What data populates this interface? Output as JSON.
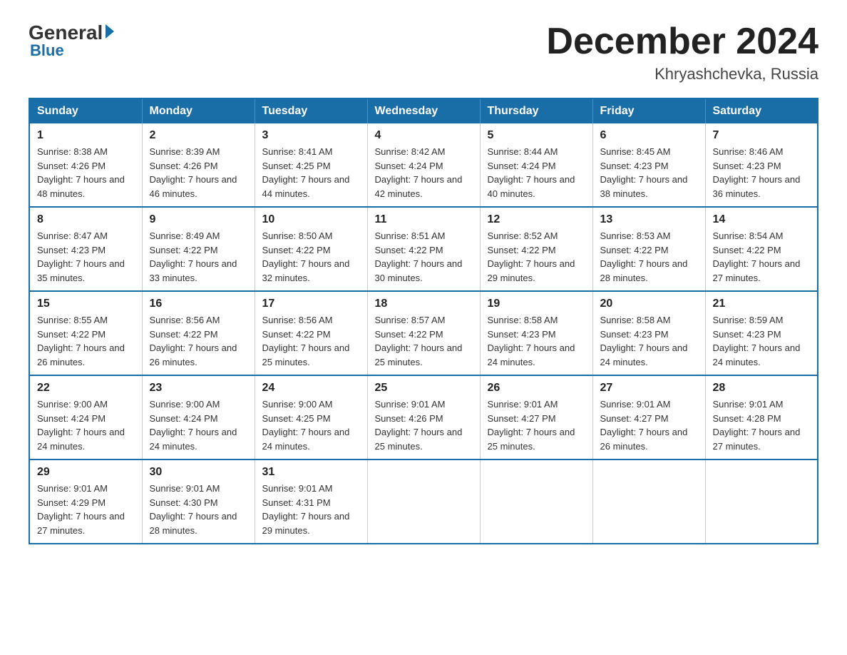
{
  "header": {
    "logo": {
      "general": "General",
      "blue": "Blue",
      "underline": "Blue"
    },
    "title": "December 2024",
    "location": "Khryashchevka, Russia"
  },
  "days_of_week": [
    "Sunday",
    "Monday",
    "Tuesday",
    "Wednesday",
    "Thursday",
    "Friday",
    "Saturday"
  ],
  "weeks": [
    [
      {
        "day": "1",
        "sunrise": "8:38 AM",
        "sunset": "4:26 PM",
        "daylight": "7 hours and 48 minutes."
      },
      {
        "day": "2",
        "sunrise": "8:39 AM",
        "sunset": "4:26 PM",
        "daylight": "7 hours and 46 minutes."
      },
      {
        "day": "3",
        "sunrise": "8:41 AM",
        "sunset": "4:25 PM",
        "daylight": "7 hours and 44 minutes."
      },
      {
        "day": "4",
        "sunrise": "8:42 AM",
        "sunset": "4:24 PM",
        "daylight": "7 hours and 42 minutes."
      },
      {
        "day": "5",
        "sunrise": "8:44 AM",
        "sunset": "4:24 PM",
        "daylight": "7 hours and 40 minutes."
      },
      {
        "day": "6",
        "sunrise": "8:45 AM",
        "sunset": "4:23 PM",
        "daylight": "7 hours and 38 minutes."
      },
      {
        "day": "7",
        "sunrise": "8:46 AM",
        "sunset": "4:23 PM",
        "daylight": "7 hours and 36 minutes."
      }
    ],
    [
      {
        "day": "8",
        "sunrise": "8:47 AM",
        "sunset": "4:23 PM",
        "daylight": "7 hours and 35 minutes."
      },
      {
        "day": "9",
        "sunrise": "8:49 AM",
        "sunset": "4:22 PM",
        "daylight": "7 hours and 33 minutes."
      },
      {
        "day": "10",
        "sunrise": "8:50 AM",
        "sunset": "4:22 PM",
        "daylight": "7 hours and 32 minutes."
      },
      {
        "day": "11",
        "sunrise": "8:51 AM",
        "sunset": "4:22 PM",
        "daylight": "7 hours and 30 minutes."
      },
      {
        "day": "12",
        "sunrise": "8:52 AM",
        "sunset": "4:22 PM",
        "daylight": "7 hours and 29 minutes."
      },
      {
        "day": "13",
        "sunrise": "8:53 AM",
        "sunset": "4:22 PM",
        "daylight": "7 hours and 28 minutes."
      },
      {
        "day": "14",
        "sunrise": "8:54 AM",
        "sunset": "4:22 PM",
        "daylight": "7 hours and 27 minutes."
      }
    ],
    [
      {
        "day": "15",
        "sunrise": "8:55 AM",
        "sunset": "4:22 PM",
        "daylight": "7 hours and 26 minutes."
      },
      {
        "day": "16",
        "sunrise": "8:56 AM",
        "sunset": "4:22 PM",
        "daylight": "7 hours and 26 minutes."
      },
      {
        "day": "17",
        "sunrise": "8:56 AM",
        "sunset": "4:22 PM",
        "daylight": "7 hours and 25 minutes."
      },
      {
        "day": "18",
        "sunrise": "8:57 AM",
        "sunset": "4:22 PM",
        "daylight": "7 hours and 25 minutes."
      },
      {
        "day": "19",
        "sunrise": "8:58 AM",
        "sunset": "4:23 PM",
        "daylight": "7 hours and 24 minutes."
      },
      {
        "day": "20",
        "sunrise": "8:58 AM",
        "sunset": "4:23 PM",
        "daylight": "7 hours and 24 minutes."
      },
      {
        "day": "21",
        "sunrise": "8:59 AM",
        "sunset": "4:23 PM",
        "daylight": "7 hours and 24 minutes."
      }
    ],
    [
      {
        "day": "22",
        "sunrise": "9:00 AM",
        "sunset": "4:24 PM",
        "daylight": "7 hours and 24 minutes."
      },
      {
        "day": "23",
        "sunrise": "9:00 AM",
        "sunset": "4:24 PM",
        "daylight": "7 hours and 24 minutes."
      },
      {
        "day": "24",
        "sunrise": "9:00 AM",
        "sunset": "4:25 PM",
        "daylight": "7 hours and 24 minutes."
      },
      {
        "day": "25",
        "sunrise": "9:01 AM",
        "sunset": "4:26 PM",
        "daylight": "7 hours and 25 minutes."
      },
      {
        "day": "26",
        "sunrise": "9:01 AM",
        "sunset": "4:27 PM",
        "daylight": "7 hours and 25 minutes."
      },
      {
        "day": "27",
        "sunrise": "9:01 AM",
        "sunset": "4:27 PM",
        "daylight": "7 hours and 26 minutes."
      },
      {
        "day": "28",
        "sunrise": "9:01 AM",
        "sunset": "4:28 PM",
        "daylight": "7 hours and 27 minutes."
      }
    ],
    [
      {
        "day": "29",
        "sunrise": "9:01 AM",
        "sunset": "4:29 PM",
        "daylight": "7 hours and 27 minutes."
      },
      {
        "day": "30",
        "sunrise": "9:01 AM",
        "sunset": "4:30 PM",
        "daylight": "7 hours and 28 minutes."
      },
      {
        "day": "31",
        "sunrise": "9:01 AM",
        "sunset": "4:31 PM",
        "daylight": "7 hours and 29 minutes."
      },
      null,
      null,
      null,
      null
    ]
  ]
}
